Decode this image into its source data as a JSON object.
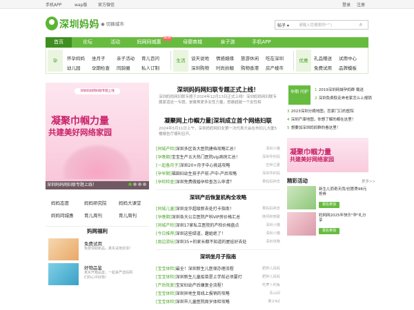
{
  "topbar": {
    "app": "手机APP",
    "wap": "wap版",
    "wechat": "官方微信",
    "login": "登录",
    "register": "注册"
  },
  "header": {
    "site_name": "深圳妈妈",
    "city": "切换城市",
    "search_select": "帖子",
    "search_placeholder": "请输入您搜索的*^)"
  },
  "nav": [
    {
      "label": "首页"
    },
    {
      "label": "论坛"
    },
    {
      "label": "活动"
    },
    {
      "label": "妈网同城惠"
    },
    {
      "label": "母婴商城"
    },
    {
      "label": "亲子游"
    },
    {
      "label": "手机APP"
    }
  ],
  "nav_new": "NEW",
  "submenu": {
    "groups": [
      {
        "cat": "孕",
        "items": [
          "怀孕妈妈",
          "坐月子",
          "亲子活动",
          "育儿百问",
          "幼儿园",
          "孕期检查",
          "同龄圈",
          "私人订制"
        ]
      },
      {
        "cat": "生活",
        "items": [
          "谈天说地",
          "情感姻缘",
          "旅游休闲",
          "吃在深圳",
          "深圳购物",
          "时尚扮靓",
          "购物香港",
          "房产楼市"
        ]
      },
      {
        "cat": "优惠",
        "items": [
          "礼品赠送",
          "试用中心",
          "免费试用",
          "品牌模板"
        ]
      }
    ]
  },
  "banner": {
    "tag": "深圳妈妈网妇联专题上线",
    "line1": "凝聚巾帼力量",
    "line2": "共建美好网络家园",
    "caption": "深圳妈妈网妇联专题上线！"
  },
  "grid": [
    [
      "妈妈态度",
      "妈妈研究院",
      "妈妈大课堂"
    ],
    [
      "妈妈同城惠",
      "育儿周刊",
      "育儿周刊"
    ]
  ],
  "welfare": {
    "title": "妈网福利",
    "items": [
      {
        "title": "免费试用",
        "desc": "免费领取新品，真实试用反馈！"
      },
      {
        "title": "好物品鉴",
        "desc": "真实开箱品鉴，一起来严选妈网们的心中好物！"
      }
    ]
  },
  "middle": {
    "headline": "深圳妈妈网妇联专题正式上线！",
    "intro": "深圳妈妈网妇联专题于2024年12月13日正式上线！深圳妈妈网妇联专属家道这一专题，是聚焦更多女性力量，搭建超越一个女性相",
    "headline2": "凝聚网上巾帼力量|深圳成立首个网络妇联",
    "intro2": "2024年5月11日上午，深圳妈妈网妇女第一次代表大会在市妇儿大厦5楼报告厅顺利召开。",
    "news1": [
      {
        "tag": "[同城产检]",
        "text": "深圳多区各大医院建档攻略汇总！",
        "src": "深圳小猫"
      },
      {
        "tag": "[孕晚期]",
        "text": "宝宝生产五大热门医院vip病房汇总！",
        "src": "深圳孕的妈"
      },
      {
        "tag": "[一起备月子]",
        "text": "深圳20+月子中心挑选攻略",
        "src": "空钟之夏"
      },
      {
        "tag": "[孕早期]",
        "text": "福田妇幼生孩子产前-产中-产后攻略",
        "src": "深圳孕的妈"
      },
      {
        "tag": "[孕检检查]",
        "text": "深圳免费做婚孕检查怎么申请？",
        "src": "果妈妈碎念"
      }
    ],
    "section2": "深圳产后恢复机构全攻略",
    "news2": [
      {
        "tag": "[同城儿童]",
        "text": "深圳龙华超级新去处打卡指南！",
        "src": "果妈妈碎念"
      },
      {
        "tag": "[孕晚期]",
        "text": "深圳各大公立医院产科VIP房价格汇总",
        "src": "随风和丽歌"
      },
      {
        "tag": "[同城产检]",
        "text": "深圳17家私立医院的产检价格盘点",
        "src": "深圳小猫"
      },
      {
        "tag": "[今日推荐]",
        "text": "深圳这些绿道，趣姐绝了！",
        "src": "深圳小猫"
      },
      {
        "tag": "[周边游玩]",
        "text": "深圳35+的家长都不知道的屋娃好去处",
        "src": "深圳攻略"
      }
    ],
    "section3": "深圳坐月子指南",
    "news3": [
      {
        "tag": "[宝宝体检]",
        "text": "最全！深圳新生儿医保办理流程",
        "src": "肥胖儿妈妈"
      },
      {
        "tag": "[宝宝体检]",
        "text": "深圳新生儿童疫苗是上学前必须要打",
        "src": "肥胖儿妈妈"
      },
      {
        "tag": "[产后恢复]",
        "text": "宝安妇幼产后康复全流程！",
        "src": "吃萝卜的兔"
      },
      {
        "tag": "[宝宝体检]",
        "text": "深圳异地生育线上报销的攻略",
        "src": "青山间"
      },
      {
        "tag": "[宝宝体检]",
        "text": "深圳市儿童医院周岁体检攻略",
        "src": "栗子NZ"
      }
    ]
  },
  "right": {
    "badge": "孕期 问护",
    "list": [
      {
        "n": "1",
        "text": "2019深圳网城孕妈群 载送"
      },
      {
        "n": "2",
        "text": "深圳免费取走奔老家怎么上报销"
      },
      {
        "n": "3",
        "text": "2023深圳分娩地图，您家门口的医院"
      },
      {
        "n": "4",
        "text": "深圳产康地图，你想了解的都在这里！"
      },
      {
        "n": "5",
        "text": "想要加深圳妈妈群的看这里！"
      }
    ],
    "banner_line1": "凝聚巾帼力量",
    "banner_line2": "共建美好网络家园",
    "activity_title": "精彩活动",
    "activity_more": "更多>>",
    "activities": [
      {
        "text": "新生儿而奇天而/创意秀98元抢券",
        "btn": "报名参加"
      },
      {
        "text": "妈网网2025年快乐\"孕\"礼分享",
        "btn": "报名参加"
      }
    ]
  }
}
